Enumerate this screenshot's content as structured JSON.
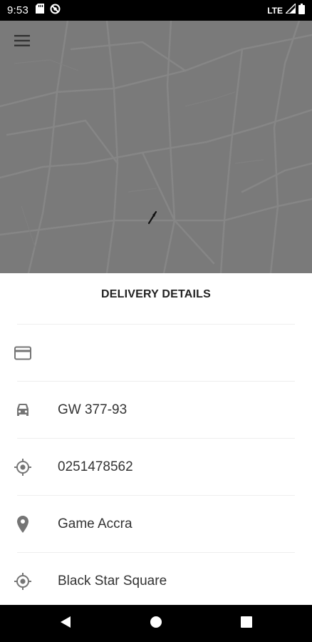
{
  "status_bar": {
    "time": "9:53",
    "network": "LTE",
    "icons": [
      "sd-card-icon",
      "no-disturb-icon",
      "signal-icon",
      "battery-icon"
    ]
  },
  "map": {
    "menu_icon": "menu-icon",
    "marker_icon": "vehicle-marker-icon"
  },
  "sheet": {
    "title": "DELIVERY DETAILS",
    "rows": [
      {
        "icon": "credit-card-icon",
        "value": ""
      },
      {
        "icon": "car-icon",
        "value": "GW 377-93"
      },
      {
        "icon": "my-location-icon",
        "value": "0251478562"
      },
      {
        "icon": "place-pin-icon",
        "value": "Game Accra"
      },
      {
        "icon": "my-location-icon",
        "value": "Black Star Square"
      }
    ]
  },
  "nav_bar": {
    "buttons": [
      "back-icon",
      "home-icon",
      "recents-icon"
    ]
  },
  "colors": {
    "map_bg": "#7a7a7a",
    "icon_gray": "#757575",
    "text": "#333333"
  }
}
